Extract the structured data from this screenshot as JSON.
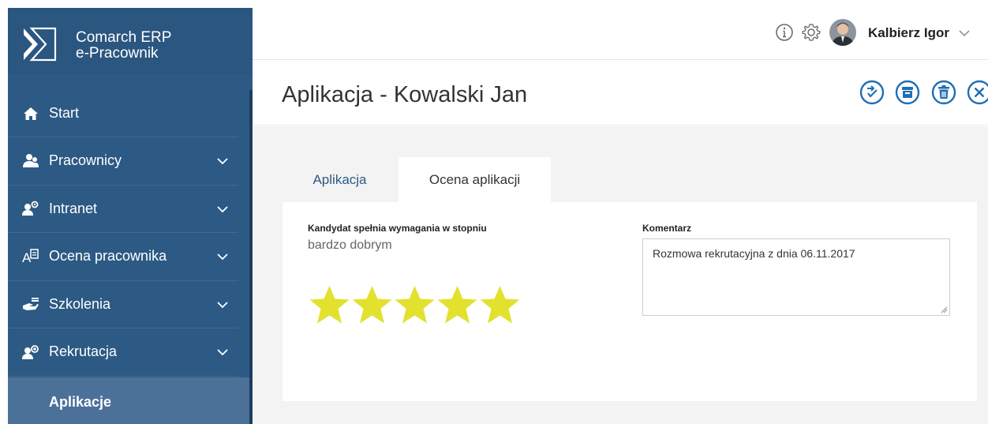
{
  "brand": {
    "line1": "Comarch ERP",
    "line2": "e-Pracownik"
  },
  "sidebar": {
    "items": [
      {
        "label": "Start",
        "icon": "home-icon",
        "expandable": false
      },
      {
        "label": "Pracownicy",
        "icon": "people-icon",
        "expandable": true
      },
      {
        "label": "Intranet",
        "icon": "intranet-icon",
        "expandable": true
      },
      {
        "label": "Ocena pracownika",
        "icon": "evaluation-icon",
        "expandable": true
      },
      {
        "label": "Szkolenia",
        "icon": "training-icon",
        "expandable": true
      },
      {
        "label": "Rekrutacja",
        "icon": "recruitment-icon",
        "expandable": true
      }
    ],
    "active_sub": "Aplikacje"
  },
  "topbar": {
    "user_name": "Kalbierz Igor"
  },
  "header": {
    "title": "Aplikacja - Kowalski Jan"
  },
  "tabs": [
    {
      "label": "Aplikacja",
      "active": false
    },
    {
      "label": "Ocena aplikacji",
      "active": true
    }
  ],
  "evaluation": {
    "requirement_label": "Kandydat spełnia wymagania w stopniu",
    "grade": "bardzo dobrym",
    "rating": 5,
    "rating_max": 5,
    "comment_label": "Komentarz",
    "comment": "Rozmowa rekrutacyjna z dnia 06.11.2017"
  },
  "colors": {
    "sidebar": "#2c5a84",
    "accent": "#1f6fb5",
    "star": "#e2e12e"
  }
}
